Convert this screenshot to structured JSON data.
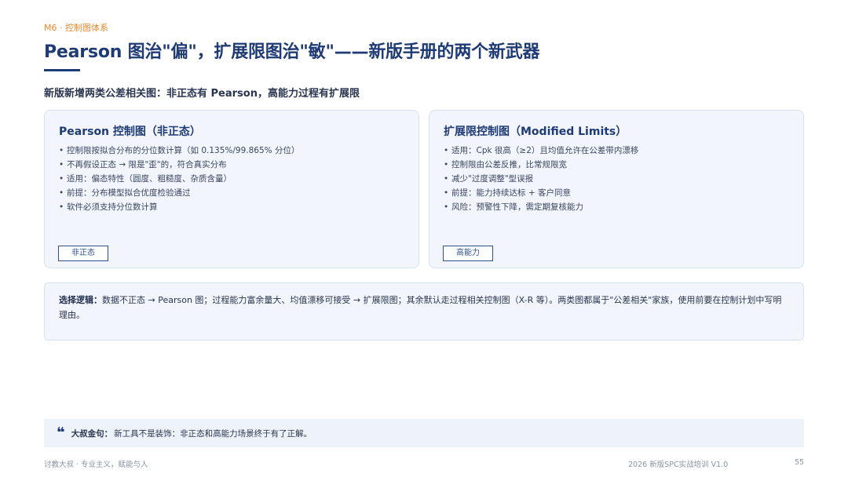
{
  "header": {
    "kicker": "M6 · 控制图体系",
    "title": "Pearson 图治\"偏\"，扩展限图治\"敏\"——新版手册的两个新武器",
    "subtitle": "新版新增两类公差相关图：非正态有 Pearson，高能力过程有扩展限"
  },
  "cards": [
    {
      "title": "Pearson 控制图（非正态）",
      "bullets": [
        "控制限按拟合分布的分位数计算（如 0.135%/99.865% 分位）",
        "不再假设正态 → 限是\"歪\"的，符合真实分布",
        "适用：偏态特性（圆度、粗糙度、杂质含量）",
        "前提：分布模型拟合优度检验通过",
        "软件必须支持分位数计算"
      ],
      "tag": "非正态"
    },
    {
      "title": "扩展限控制图（Modified Limits）",
      "bullets": [
        "适用：Cpk 很高（≥2）且均值允许在公差带内漂移",
        "控制限由公差反推，比常规限宽",
        "减少\"过度调整\"型误报",
        "前提：能力持续达标 + 客户同意",
        "风险：预警性下降，需定期复核能力"
      ],
      "tag": "高能力"
    }
  ],
  "logic": {
    "label": "选择逻辑：",
    "text": "数据不正态 → Pearson 图；过程能力富余量大、均值漂移可接受 → 扩展限图；其余默认走过程相关控制图（X-R 等）。两类图都属于\"公差相关\"家族，使用前要在控制计划中写明理由。"
  },
  "quote": {
    "icon": "quote-icon",
    "label": "大叔金句：",
    "text": "新工具不是装饰：非正态和高能力场景终于有了正解。"
  },
  "footer": {
    "left": "讨教大叔 · 专业主义，赋能与人",
    "center": "2026 新版SPC实战培训 V1.0",
    "page": "55"
  },
  "colors": {
    "accent": "#1f3b75",
    "kicker": "#e8892b",
    "card_bg": "#f2f6fc"
  }
}
